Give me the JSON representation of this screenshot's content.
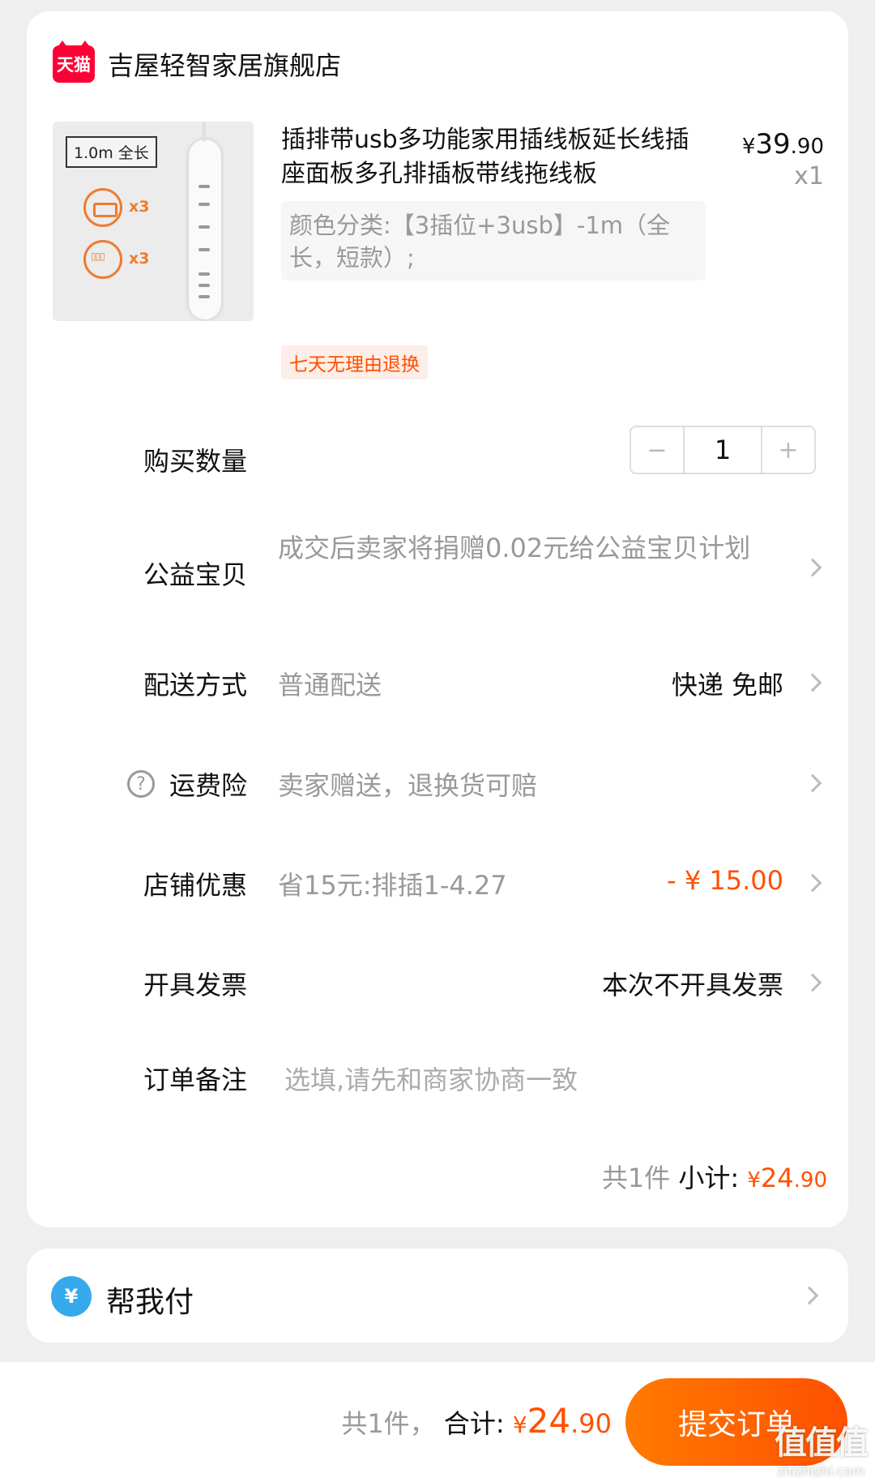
{
  "shop": {
    "badge": "天猫",
    "name": "吉屋轻智家居旗舰店"
  },
  "product": {
    "image_label": "1.0m 全长",
    "image_count_a": "x3",
    "image_count_b": "x3",
    "title": "插排带usb多功能家用插线板延长线插座面板多孔排插板带线拖线板",
    "price_currency": "¥",
    "price_int": "39",
    "price_dec": ".90",
    "quantity": "x1",
    "sku": "颜色分类:【3插位+3usb】-1m（全长，短款）;",
    "return_tag": "七天无理由退换"
  },
  "rows": {
    "quantity": {
      "label": "购买数量",
      "minus": "−",
      "value": "1",
      "plus": "+"
    },
    "charity": {
      "label": "公益宝贝",
      "value": "成交后卖家将捐赠0.02元给公益宝贝计划"
    },
    "delivery": {
      "label": "配送方式",
      "value": "普通配送",
      "right": "快递 免邮"
    },
    "insurance": {
      "help_icon": "?",
      "label": "运费险",
      "value": "卖家赠送，退换货可赔"
    },
    "discount": {
      "label": "店铺优惠",
      "value": "省15元:排插1-4.27",
      "right": "- ¥ 15.00"
    },
    "invoice": {
      "label": "开具发票",
      "right": "本次不开具发票"
    },
    "note": {
      "label": "订单备注",
      "placeholder": "选填,请先和商家协商一致"
    }
  },
  "subtotal": {
    "count": "共1件",
    "label": "小计:",
    "currency": "¥",
    "int": "24",
    "dec": ".90"
  },
  "help_pay": {
    "icon": "¥",
    "label": "帮我付"
  },
  "footer": {
    "count": "共1件，",
    "label": "合计:",
    "currency": "¥",
    "int": "24",
    "dec": ".90",
    "submit": "提交订单",
    "watermark": "值值值",
    "watermark_url": "zhizhizhi.com"
  },
  "colors": {
    "accent": "#ff5000",
    "tmall": "#ff0036",
    "help_blue": "#36a9ec"
  },
  "icons": [
    "tmall-icon",
    "minus-icon",
    "plus-icon",
    "chevron-right-icon",
    "question-icon",
    "yen-icon"
  ]
}
